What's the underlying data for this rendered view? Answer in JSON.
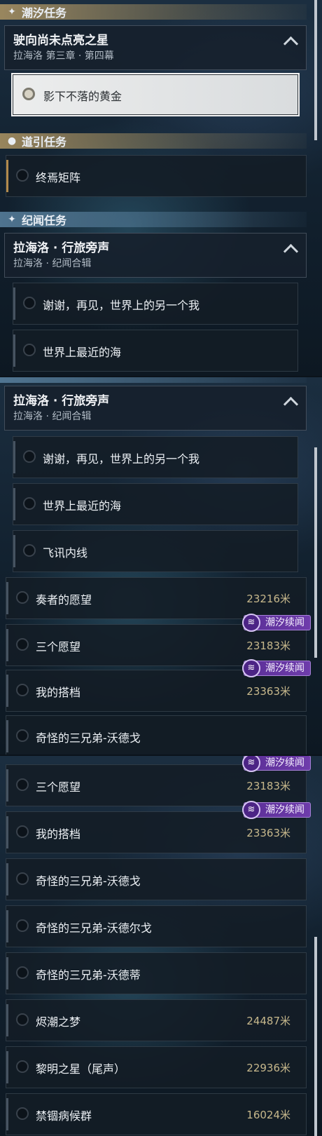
{
  "sections": {
    "tide": "潮汐任务",
    "guide": "道引任务",
    "chronicle": "纪闻任务"
  },
  "tide_group": {
    "title": "驶向尚未点亮之星",
    "subtitle": "拉海洛 第三章 · 第四幕"
  },
  "active_quest": "影下不落的黄金",
  "guide_quest": "终焉矩阵",
  "chronicle_group": {
    "title": "拉海洛 · 行旅旁声",
    "subtitle": "拉海洛 · 纪闻合辑"
  },
  "chronicle_sub": [
    "谢谢，再见，世界上的另一个我",
    "世界上最近的海",
    "飞讯内线"
  ],
  "badge_label": "潮汐续闻",
  "quests": [
    {
      "name": "奏者的愿望",
      "distance": "23216米"
    },
    {
      "name": "三个愿望",
      "distance": "23183米"
    },
    {
      "name": "我的搭档",
      "distance": "23363米"
    },
    {
      "name": "奇怪的三兄弟-沃德戈",
      "distance": ""
    },
    {
      "name": "奇怪的三兄弟-沃德尔戈",
      "distance": ""
    },
    {
      "name": "奇怪的三兄弟-沃德蒂",
      "distance": ""
    },
    {
      "name": "烬潮之梦",
      "distance": "24487米"
    },
    {
      "name": "黎明之星（尾声）",
      "distance": "22936米"
    },
    {
      "name": "禁锢病候群",
      "distance": "16024米"
    }
  ],
  "colors": {
    "gold_section": "#af9664",
    "teal_section": "#5a82a0",
    "badge": "#5b2f97",
    "distance": "#c7b88c"
  }
}
